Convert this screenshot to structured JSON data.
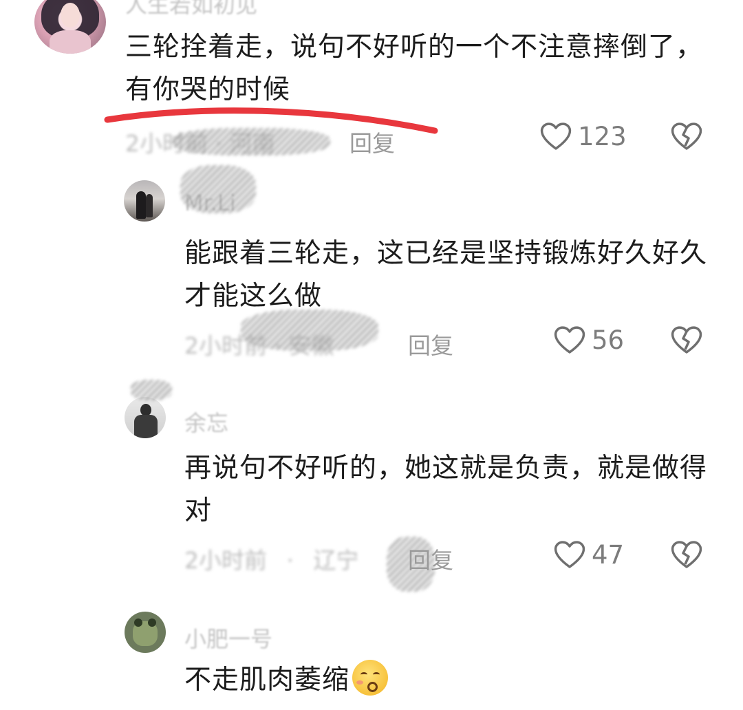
{
  "comments": [
    {
      "username": "人生若如初见",
      "text": "三轮拴着走，说句不好听的一个不注意摔倒了，有你哭的时候",
      "time_location": "2小时前 · 河南",
      "reply_label": "回复",
      "likes": "123"
    },
    {
      "username": "Mr.Li",
      "text": "能跟着三轮走，这已经是坚持锻炼好久好久才能这么做",
      "time_location": "2小时前 · 安徽",
      "reply_label": "回复",
      "likes": "56"
    },
    {
      "username": "余忘",
      "text": "再说句不好听的，她这就是负责，就是做得对",
      "time": "2小时前",
      "location": "辽宁",
      "reply_label": "回复",
      "likes": "47"
    },
    {
      "username": "小肥一号",
      "text": "不走肌肉萎缩",
      "emoji": "sweat-kiss-emoji"
    }
  ],
  "icons": {
    "like": "heart-outline-icon",
    "dislike": "broken-heart-icon"
  },
  "colors": {
    "underline": "#e8373d",
    "text": "#1c1c1c",
    "meta": "#bdbdbd",
    "reply": "#9a9a9a"
  }
}
